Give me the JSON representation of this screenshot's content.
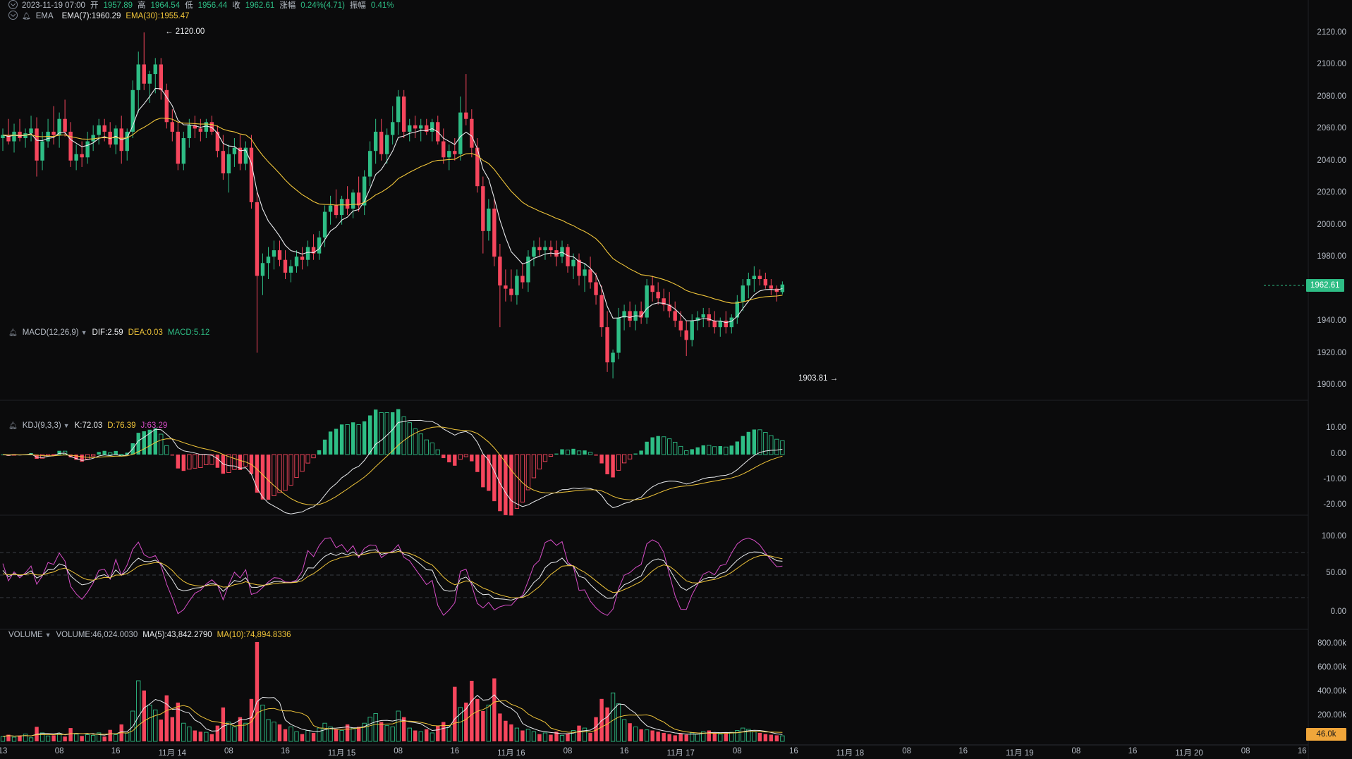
{
  "header": {
    "datetime": "2023-11-19 07:00",
    "open_label": "开",
    "open": "1957.89",
    "high_label": "高",
    "high": "1964.54",
    "low_label": "低",
    "low": "1956.44",
    "close_label": "收",
    "close": "1962.61",
    "change_label": "涨幅",
    "change": "0.24%(4.71)",
    "amplitude_label": "振幅",
    "amplitude": "0.41%"
  },
  "indicators": {
    "ema": {
      "name": "EMA",
      "ema7": "EMA(7):1960.29",
      "ema30": "EMA(30):1955.47"
    },
    "macd": {
      "name": "MACD(12,26,9)",
      "dif": "DIF:2.59",
      "dea": "DEA:0.03",
      "macd": "MACD:5.12"
    },
    "kdj": {
      "name": "KDJ(9,3,3)",
      "k": "K:72.03",
      "d": "D:76.39",
      "j": "J:63.29"
    },
    "volume": {
      "name": "VOLUME",
      "vol": "VOLUME:46,024.0030",
      "ma5": "MA(5):43,842.2790",
      "ma10": "MA(10):74,894.8336"
    }
  },
  "axes": {
    "price": [
      "2120.00",
      "2100.00",
      "2080.00",
      "2060.00",
      "2040.00",
      "2020.00",
      "2000.00",
      "1980.00",
      "1960.00",
      "1940.00",
      "1920.00",
      "1900.00"
    ],
    "macd": [
      "10.00",
      "0.00",
      "-10.00",
      "-20.00"
    ],
    "kdj": [
      "100.00",
      "50.00",
      "0.00"
    ],
    "volume": [
      "800.00k",
      "600.00k",
      "400.00k",
      "200.00k"
    ],
    "time": [
      "13",
      "08",
      "16",
      "11月 14",
      "08",
      "16",
      "11月 15",
      "08",
      "16",
      "11月 16",
      "08",
      "16",
      "11月 17",
      "08",
      "16",
      "11月 18",
      "08",
      "16",
      "11月 19",
      "08",
      "16",
      "11月 20",
      "08",
      "16"
    ]
  },
  "tags": {
    "price": "1962.61",
    "volume": "46.0k"
  },
  "annotations": {
    "high": "← 2120.00",
    "low": "1903.81 →"
  },
  "colors": {
    "up": "#2ebd85",
    "down": "#f6465d",
    "ema7": "#e8eaed",
    "ema30": "#f0c53a",
    "kdj_j": "#d74dc7",
    "bg": "#0b0b0c"
  },
  "chart_data": {
    "type": "candlestick",
    "interval": "1h",
    "price_range": [
      1900,
      2130
    ],
    "candles": [
      {
        "o": 2054,
        "h": 2060,
        "l": 2046,
        "c": 2056
      },
      {
        "o": 2056,
        "h": 2066,
        "l": 2050,
        "c": 2052
      },
      {
        "o": 2052,
        "h": 2063,
        "l": 2045,
        "c": 2058
      },
      {
        "o": 2058,
        "h": 2066,
        "l": 2052,
        "c": 2054
      },
      {
        "o": 2054,
        "h": 2060,
        "l": 2048,
        "c": 2057
      },
      {
        "o": 2057,
        "h": 2068,
        "l": 2052,
        "c": 2060
      },
      {
        "o": 2060,
        "h": 2067,
        "l": 2030,
        "c": 2040
      },
      {
        "o": 2040,
        "h": 2058,
        "l": 2034,
        "c": 2052
      },
      {
        "o": 2052,
        "h": 2066,
        "l": 2048,
        "c": 2058
      },
      {
        "o": 2058,
        "h": 2074,
        "l": 2050,
        "c": 2056
      },
      {
        "o": 2056,
        "h": 2070,
        "l": 2048,
        "c": 2066
      },
      {
        "o": 2066,
        "h": 2078,
        "l": 2055,
        "c": 2058
      },
      {
        "o": 2058,
        "h": 2064,
        "l": 2036,
        "c": 2040
      },
      {
        "o": 2040,
        "h": 2050,
        "l": 2034,
        "c": 2044
      },
      {
        "o": 2044,
        "h": 2052,
        "l": 2036,
        "c": 2042
      },
      {
        "o": 2042,
        "h": 2058,
        "l": 2038,
        "c": 2052
      },
      {
        "o": 2052,
        "h": 2062,
        "l": 2046,
        "c": 2056
      },
      {
        "o": 2056,
        "h": 2066,
        "l": 2050,
        "c": 2062
      },
      {
        "o": 2062,
        "h": 2066,
        "l": 2052,
        "c": 2058
      },
      {
        "o": 2058,
        "h": 2064,
        "l": 2048,
        "c": 2050
      },
      {
        "o": 2050,
        "h": 2062,
        "l": 2044,
        "c": 2060
      },
      {
        "o": 2060,
        "h": 2068,
        "l": 2038,
        "c": 2046
      },
      {
        "o": 2046,
        "h": 2060,
        "l": 2040,
        "c": 2058
      },
      {
        "o": 2058,
        "h": 2090,
        "l": 2054,
        "c": 2084
      },
      {
        "o": 2084,
        "h": 2108,
        "l": 2070,
        "c": 2100
      },
      {
        "o": 2100,
        "h": 2120,
        "l": 2084,
        "c": 2088
      },
      {
        "o": 2088,
        "h": 2096,
        "l": 2076,
        "c": 2094
      },
      {
        "o": 2094,
        "h": 2104,
        "l": 2082,
        "c": 2100
      },
      {
        "o": 2100,
        "h": 2104,
        "l": 2078,
        "c": 2084
      },
      {
        "o": 2084,
        "h": 2088,
        "l": 2060,
        "c": 2064
      },
      {
        "o": 2064,
        "h": 2072,
        "l": 2052,
        "c": 2058
      },
      {
        "o": 2058,
        "h": 2064,
        "l": 2034,
        "c": 2038
      },
      {
        "o": 2038,
        "h": 2058,
        "l": 2034,
        "c": 2054
      },
      {
        "o": 2054,
        "h": 2066,
        "l": 2048,
        "c": 2062
      },
      {
        "o": 2062,
        "h": 2068,
        "l": 2054,
        "c": 2060
      },
      {
        "o": 2060,
        "h": 2066,
        "l": 2052,
        "c": 2058
      },
      {
        "o": 2058,
        "h": 2066,
        "l": 2054,
        "c": 2064
      },
      {
        "o": 2064,
        "h": 2068,
        "l": 2056,
        "c": 2058
      },
      {
        "o": 2058,
        "h": 2062,
        "l": 2042,
        "c": 2046
      },
      {
        "o": 2046,
        "h": 2056,
        "l": 2028,
        "c": 2032
      },
      {
        "o": 2032,
        "h": 2050,
        "l": 2020,
        "c": 2044
      },
      {
        "o": 2044,
        "h": 2054,
        "l": 2036,
        "c": 2048
      },
      {
        "o": 2048,
        "h": 2056,
        "l": 2034,
        "c": 2038
      },
      {
        "o": 2038,
        "h": 2052,
        "l": 2034,
        "c": 2048
      },
      {
        "o": 2048,
        "h": 2056,
        "l": 2010,
        "c": 2014
      },
      {
        "o": 2014,
        "h": 2020,
        "l": 1920,
        "c": 1968
      },
      {
        "o": 1968,
        "h": 1982,
        "l": 1956,
        "c": 1976
      },
      {
        "o": 1976,
        "h": 1986,
        "l": 1966,
        "c": 1980
      },
      {
        "o": 1980,
        "h": 1990,
        "l": 1972,
        "c": 1984
      },
      {
        "o": 1984,
        "h": 1990,
        "l": 1974,
        "c": 1978
      },
      {
        "o": 1978,
        "h": 1984,
        "l": 1966,
        "c": 1970
      },
      {
        "o": 1970,
        "h": 1978,
        "l": 1964,
        "c": 1974
      },
      {
        "o": 1974,
        "h": 1984,
        "l": 1970,
        "c": 1980
      },
      {
        "o": 1980,
        "h": 1986,
        "l": 1972,
        "c": 1978
      },
      {
        "o": 1978,
        "h": 1990,
        "l": 1974,
        "c": 1986
      },
      {
        "o": 1986,
        "h": 1994,
        "l": 1978,
        "c": 1982
      },
      {
        "o": 1982,
        "h": 1996,
        "l": 1978,
        "c": 1992
      },
      {
        "o": 1992,
        "h": 2012,
        "l": 1986,
        "c": 2008
      },
      {
        "o": 2008,
        "h": 2018,
        "l": 2000,
        "c": 2012
      },
      {
        "o": 2012,
        "h": 2022,
        "l": 2004,
        "c": 2006
      },
      {
        "o": 2006,
        "h": 2018,
        "l": 2000,
        "c": 2016
      },
      {
        "o": 2016,
        "h": 2024,
        "l": 2006,
        "c": 2010
      },
      {
        "o": 2010,
        "h": 2022,
        "l": 2004,
        "c": 2020
      },
      {
        "o": 2020,
        "h": 2030,
        "l": 2008,
        "c": 2012
      },
      {
        "o": 2012,
        "h": 2034,
        "l": 2006,
        "c": 2030
      },
      {
        "o": 2030,
        "h": 2052,
        "l": 2024,
        "c": 2046
      },
      {
        "o": 2046,
        "h": 2066,
        "l": 2038,
        "c": 2058
      },
      {
        "o": 2058,
        "h": 2066,
        "l": 2040,
        "c": 2044
      },
      {
        "o": 2044,
        "h": 2060,
        "l": 2038,
        "c": 2056
      },
      {
        "o": 2056,
        "h": 2074,
        "l": 2050,
        "c": 2064
      },
      {
        "o": 2064,
        "h": 2084,
        "l": 2056,
        "c": 2080
      },
      {
        "o": 2080,
        "h": 2084,
        "l": 2054,
        "c": 2058
      },
      {
        "o": 2058,
        "h": 2066,
        "l": 2052,
        "c": 2062
      },
      {
        "o": 2062,
        "h": 2068,
        "l": 2054,
        "c": 2060
      },
      {
        "o": 2060,
        "h": 2066,
        "l": 2052,
        "c": 2062
      },
      {
        "o": 2062,
        "h": 2066,
        "l": 2056,
        "c": 2058
      },
      {
        "o": 2058,
        "h": 2066,
        "l": 2052,
        "c": 2064
      },
      {
        "o": 2064,
        "h": 2068,
        "l": 2050,
        "c": 2052
      },
      {
        "o": 2052,
        "h": 2060,
        "l": 2038,
        "c": 2042
      },
      {
        "o": 2042,
        "h": 2050,
        "l": 2034,
        "c": 2046
      },
      {
        "o": 2046,
        "h": 2054,
        "l": 2040,
        "c": 2044
      },
      {
        "o": 2044,
        "h": 2080,
        "l": 2040,
        "c": 2070
      },
      {
        "o": 2070,
        "h": 2094,
        "l": 2062,
        "c": 2066
      },
      {
        "o": 2066,
        "h": 2072,
        "l": 2042,
        "c": 2048
      },
      {
        "o": 2048,
        "h": 2054,
        "l": 2020,
        "c": 2024
      },
      {
        "o": 2024,
        "h": 2030,
        "l": 1982,
        "c": 1996
      },
      {
        "o": 1996,
        "h": 2016,
        "l": 1990,
        "c": 2010
      },
      {
        "o": 2010,
        "h": 2016,
        "l": 1974,
        "c": 1980
      },
      {
        "o": 1980,
        "h": 1988,
        "l": 1936,
        "c": 1962
      },
      {
        "o": 1962,
        "h": 1972,
        "l": 1952,
        "c": 1960
      },
      {
        "o": 1960,
        "h": 1972,
        "l": 1952,
        "c": 1956
      },
      {
        "o": 1956,
        "h": 1972,
        "l": 1950,
        "c": 1968
      },
      {
        "o": 1968,
        "h": 1976,
        "l": 1960,
        "c": 1964
      },
      {
        "o": 1964,
        "h": 1984,
        "l": 1958,
        "c": 1980
      },
      {
        "o": 1980,
        "h": 1990,
        "l": 1974,
        "c": 1986
      },
      {
        "o": 1986,
        "h": 1992,
        "l": 1980,
        "c": 1984
      },
      {
        "o": 1984,
        "h": 1990,
        "l": 1978,
        "c": 1986
      },
      {
        "o": 1986,
        "h": 1990,
        "l": 1980,
        "c": 1984
      },
      {
        "o": 1984,
        "h": 1990,
        "l": 1974,
        "c": 1980
      },
      {
        "o": 1980,
        "h": 1990,
        "l": 1976,
        "c": 1986
      },
      {
        "o": 1986,
        "h": 1988,
        "l": 1970,
        "c": 1974
      },
      {
        "o": 1974,
        "h": 1982,
        "l": 1966,
        "c": 1978
      },
      {
        "o": 1978,
        "h": 1982,
        "l": 1962,
        "c": 1968
      },
      {
        "o": 1968,
        "h": 1976,
        "l": 1958,
        "c": 1972
      },
      {
        "o": 1972,
        "h": 1980,
        "l": 1960,
        "c": 1964
      },
      {
        "o": 1964,
        "h": 1970,
        "l": 1950,
        "c": 1956
      },
      {
        "o": 1956,
        "h": 1962,
        "l": 1930,
        "c": 1936
      },
      {
        "o": 1936,
        "h": 1946,
        "l": 1908,
        "c": 1914
      },
      {
        "o": 1914,
        "h": 1922,
        "l": 1904,
        "c": 1920
      },
      {
        "o": 1920,
        "h": 1948,
        "l": 1916,
        "c": 1942
      },
      {
        "o": 1942,
        "h": 1950,
        "l": 1934,
        "c": 1946
      },
      {
        "o": 1946,
        "h": 1952,
        "l": 1936,
        "c": 1940
      },
      {
        "o": 1940,
        "h": 1950,
        "l": 1934,
        "c": 1946
      },
      {
        "o": 1946,
        "h": 1952,
        "l": 1938,
        "c": 1942
      },
      {
        "o": 1942,
        "h": 1966,
        "l": 1938,
        "c": 1962
      },
      {
        "o": 1962,
        "h": 1968,
        "l": 1952,
        "c": 1958
      },
      {
        "o": 1958,
        "h": 1964,
        "l": 1950,
        "c": 1954
      },
      {
        "o": 1954,
        "h": 1960,
        "l": 1946,
        "c": 1950
      },
      {
        "o": 1950,
        "h": 1958,
        "l": 1942,
        "c": 1946
      },
      {
        "o": 1946,
        "h": 1952,
        "l": 1936,
        "c": 1940
      },
      {
        "o": 1940,
        "h": 1946,
        "l": 1930,
        "c": 1934
      },
      {
        "o": 1934,
        "h": 1940,
        "l": 1918,
        "c": 1928
      },
      {
        "o": 1928,
        "h": 1944,
        "l": 1924,
        "c": 1940
      },
      {
        "o": 1940,
        "h": 1946,
        "l": 1934,
        "c": 1942
      },
      {
        "o": 1942,
        "h": 1948,
        "l": 1936,
        "c": 1944
      },
      {
        "o": 1944,
        "h": 1948,
        "l": 1936,
        "c": 1940
      },
      {
        "o": 1940,
        "h": 1946,
        "l": 1932,
        "c": 1936
      },
      {
        "o": 1936,
        "h": 1942,
        "l": 1930,
        "c": 1940
      },
      {
        "o": 1940,
        "h": 1946,
        "l": 1932,
        "c": 1936
      },
      {
        "o": 1936,
        "h": 1944,
        "l": 1932,
        "c": 1942
      },
      {
        "o": 1942,
        "h": 1956,
        "l": 1938,
        "c": 1952
      },
      {
        "o": 1952,
        "h": 1966,
        "l": 1946,
        "c": 1962
      },
      {
        "o": 1962,
        "h": 1970,
        "l": 1954,
        "c": 1966
      },
      {
        "o": 1966,
        "h": 1974,
        "l": 1958,
        "c": 1968
      },
      {
        "o": 1968,
        "h": 1972,
        "l": 1962,
        "c": 1966
      },
      {
        "o": 1966,
        "h": 1970,
        "l": 1960,
        "c": 1962
      },
      {
        "o": 1962,
        "h": 1966,
        "l": 1956,
        "c": 1960
      },
      {
        "o": 1960,
        "h": 1962,
        "l": 1952,
        "c": 1958
      },
      {
        "o": 1957.89,
        "h": 1964.54,
        "l": 1956.44,
        "c": 1962.61
      }
    ],
    "volume": [
      40,
      55,
      35,
      48,
      60,
      30,
      120,
      70,
      45,
      50,
      65,
      40,
      110,
      60,
      45,
      55,
      50,
      70,
      40,
      95,
      55,
      140,
      70,
      250,
      500,
      420,
      300,
      260,
      180,
      380,
      200,
      320,
      150,
      120,
      90,
      80,
      75,
      60,
      130,
      280,
      160,
      120,
      200,
      150,
      350,
      820,
      300,
      180,
      160,
      140,
      100,
      120,
      80,
      60,
      90,
      70,
      110,
      150,
      120,
      100,
      90,
      140,
      110,
      120,
      150,
      200,
      230,
      160,
      130,
      120,
      250,
      200,
      110,
      90,
      80,
      100,
      70,
      130,
      160,
      120,
      450,
      280,
      320,
      500,
      350,
      250,
      300,
      520,
      230,
      170,
      140,
      110,
      90,
      100,
      80,
      60,
      70,
      55,
      80,
      50,
      65,
      90,
      130,
      110,
      70,
      200,
      350,
      280,
      400,
      310,
      180,
      150,
      120,
      100,
      95,
      90,
      80,
      70,
      60,
      50,
      65,
      55,
      70,
      60,
      80,
      90,
      70,
      60,
      65,
      75,
      90,
      110,
      100,
      80,
      70,
      60,
      55,
      50,
      46
    ]
  }
}
